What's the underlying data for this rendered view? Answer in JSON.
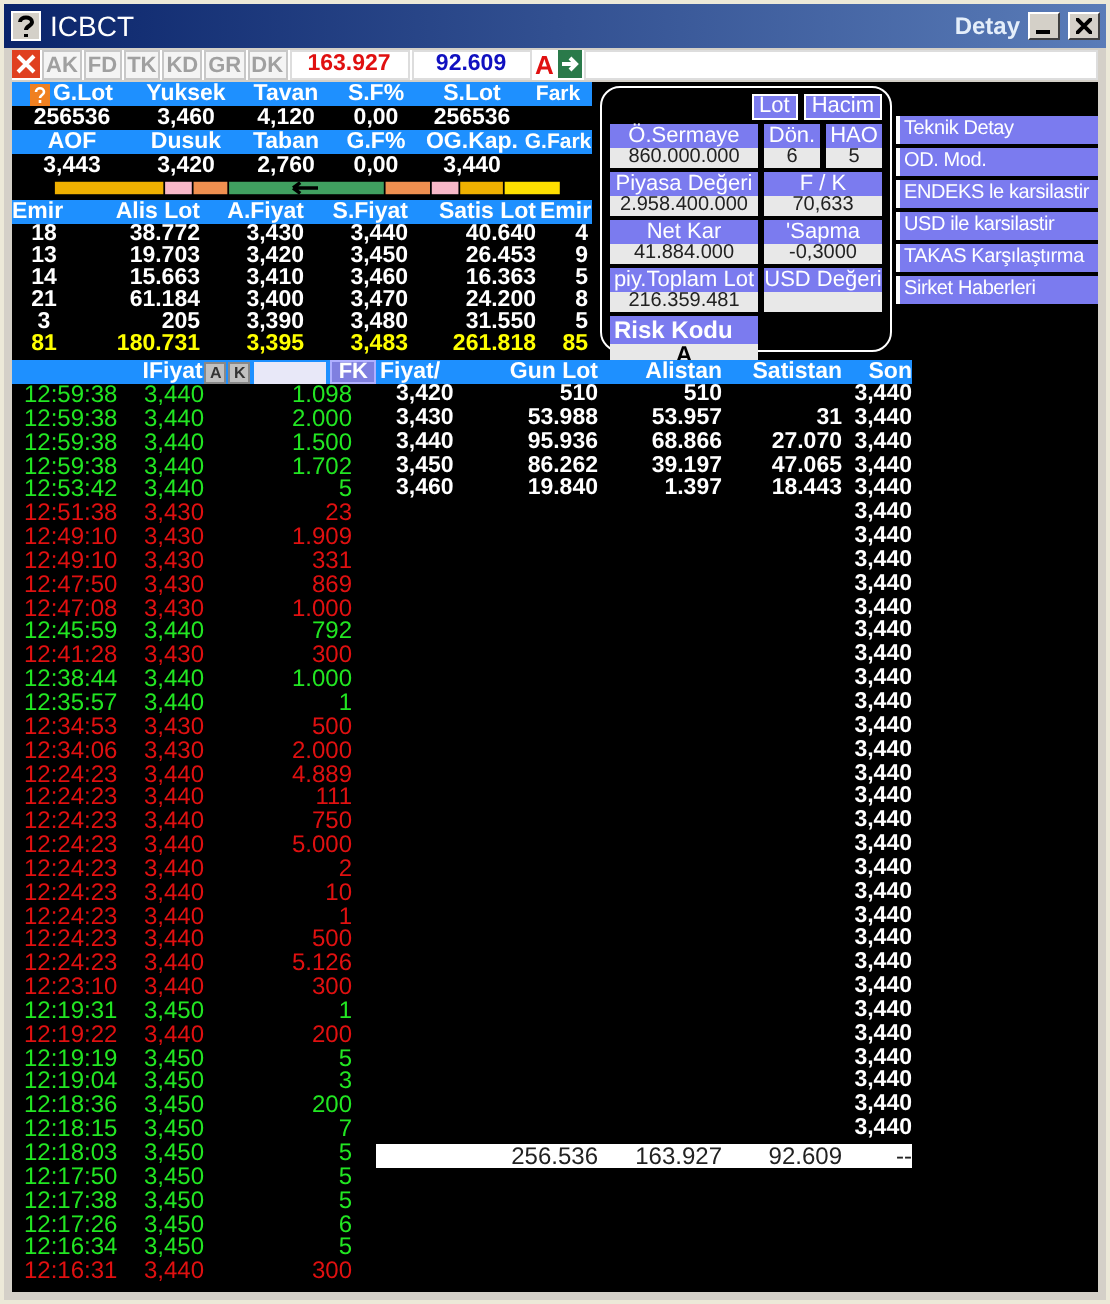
{
  "window": {
    "title": "ICBCT",
    "subtitle": "Detay"
  },
  "toolbar": {
    "tabs": [
      "AK",
      "FD",
      "TK",
      "KD",
      "GR",
      "DK"
    ],
    "field_1": "163.927",
    "field_2": "92.609",
    "mode": "A"
  },
  "stats": [
    [
      {
        "label": "G.Lot",
        "value": "256536"
      },
      {
        "label": "Yuksek",
        "value": "3,460"
      },
      {
        "label": "Tavan",
        "value": "4,120"
      },
      {
        "label": "S.F%",
        "value": "0,00"
      },
      {
        "label": "S.Lot",
        "value": "256536"
      },
      {
        "label": "Fark"
      }
    ],
    [
      {
        "label": "AOF",
        "value": "3,443"
      },
      {
        "label": "Dusuk",
        "value": "3,420"
      },
      {
        "label": "Taban",
        "value": "2,760"
      },
      {
        "label": "G.F%",
        "value": "0,00"
      },
      {
        "label": "OG.Kap.",
        "value": "3,440"
      },
      {
        "label": "G.Fark"
      }
    ]
  ],
  "order_book": {
    "columns": [
      "Emir",
      "Alis Lot",
      "A.Fiyat",
      "S.Fiyat",
      "Satis Lot",
      "Emir"
    ],
    "rows": [
      [
        "18",
        "38.772",
        "3,430",
        "3,440",
        "40.640",
        "4"
      ],
      [
        "13",
        "19.703",
        "3,420",
        "3,450",
        "26.453",
        "9"
      ],
      [
        "14",
        "15.663",
        "3,410",
        "3,460",
        "16.363",
        "5"
      ],
      [
        "21",
        "61.184",
        "3,400",
        "3,470",
        "24.200",
        "8"
      ],
      [
        "3",
        "205",
        "3,390",
        "3,480",
        "31.550",
        "5"
      ]
    ],
    "totals": [
      "81",
      "180.731",
      "3,395",
      "3,483",
      "261.818",
      "85"
    ]
  },
  "detail": {
    "unit_buttons": [
      "Lot",
      "Hacim"
    ],
    "rows": [
      [
        {
          "label": "Ö.Sermaye",
          "value": "860.000.000"
        },
        {
          "label": "Dön.",
          "value": "6"
        },
        {
          "label": "HAO",
          "value": "5"
        }
      ],
      [
        {
          "label": "Piyasa Değeri",
          "value": "2.958.400.000"
        },
        {
          "label": "F / K",
          "value": "70,633"
        }
      ],
      [
        {
          "label": "Net Kar",
          "value": "41.884.000"
        },
        {
          "label": "'Sapma",
          "value": "-0,3000"
        }
      ],
      [
        {
          "label": "piy.Toplam Lot",
          "value": "216.359.481"
        },
        {
          "label": "USD Değeri"
        }
      ]
    ],
    "risk": {
      "label": "Risk Kodu",
      "value": "A"
    }
  },
  "links": [
    "Teknik Detay",
    "OD. Mod.",
    "ENDEKS le karsilastir",
    "USD ile karsilastir",
    "TAKAS Karşılaştırma",
    "Sirket Haberleri"
  ],
  "trades_header": {
    "label": "IFiyat",
    "buttons": [
      "A",
      "K"
    ],
    "filter": "FK"
  },
  "trades": [
    {
      "time": "12:59:38",
      "price": "3,440",
      "lot": "1.098",
      "kind": "buy"
    },
    {
      "time": "12:59:38",
      "price": "3,440",
      "lot": "2.000",
      "kind": "buy"
    },
    {
      "time": "12:59:38",
      "price": "3,440",
      "lot": "1.500",
      "kind": "buy"
    },
    {
      "time": "12:59:38",
      "price": "3,440",
      "lot": "1.702",
      "kind": "buy"
    },
    {
      "time": "12:53:42",
      "price": "3,440",
      "lot": "5",
      "kind": "buy"
    },
    {
      "time": "12:51:38",
      "price": "3,430",
      "lot": "23",
      "kind": "sell"
    },
    {
      "time": "12:49:10",
      "price": "3,430",
      "lot": "1.909",
      "kind": "sell"
    },
    {
      "time": "12:49:10",
      "price": "3,430",
      "lot": "331",
      "kind": "sell"
    },
    {
      "time": "12:47:50",
      "price": "3,430",
      "lot": "869",
      "kind": "sell"
    },
    {
      "time": "12:47:08",
      "price": "3,430",
      "lot": "1.000",
      "kind": "sell"
    },
    {
      "time": "12:45:59",
      "price": "3,440",
      "lot": "792",
      "kind": "buy"
    },
    {
      "time": "12:41:28",
      "price": "3,430",
      "lot": "300",
      "kind": "sell"
    },
    {
      "time": "12:38:44",
      "price": "3,440",
      "lot": "1.000",
      "kind": "buy"
    },
    {
      "time": "12:35:57",
      "price": "3,440",
      "lot": "1",
      "kind": "buy"
    },
    {
      "time": "12:34:53",
      "price": "3,430",
      "lot": "500",
      "kind": "sell"
    },
    {
      "time": "12:34:06",
      "price": "3,430",
      "lot": "2.000",
      "kind": "sell"
    },
    {
      "time": "12:24:23",
      "price": "3,440",
      "lot": "4.889",
      "kind": "sell"
    },
    {
      "time": "12:24:23",
      "price": "3,440",
      "lot": "111",
      "kind": "sell"
    },
    {
      "time": "12:24:23",
      "price": "3,440",
      "lot": "750",
      "kind": "sell"
    },
    {
      "time": "12:24:23",
      "price": "3,440",
      "lot": "5.000",
      "kind": "sell"
    },
    {
      "time": "12:24:23",
      "price": "3,440",
      "lot": "2",
      "kind": "sell"
    },
    {
      "time": "12:24:23",
      "price": "3,440",
      "lot": "10",
      "kind": "sell"
    },
    {
      "time": "12:24:23",
      "price": "3,440",
      "lot": "1",
      "kind": "sell"
    },
    {
      "time": "12:24:23",
      "price": "3,440",
      "lot": "500",
      "kind": "sell"
    },
    {
      "time": "12:24:23",
      "price": "3,440",
      "lot": "5.126",
      "kind": "sell"
    },
    {
      "time": "12:23:10",
      "price": "3,440",
      "lot": "300",
      "kind": "sell"
    },
    {
      "time": "12:19:31",
      "price": "3,450",
      "lot": "1",
      "kind": "buy"
    },
    {
      "time": "12:19:22",
      "price": "3,440",
      "lot": "200",
      "kind": "sell"
    },
    {
      "time": "12:19:19",
      "price": "3,450",
      "lot": "5",
      "kind": "buy"
    },
    {
      "time": "12:19:04",
      "price": "3,450",
      "lot": "3",
      "kind": "buy"
    },
    {
      "time": "12:18:36",
      "price": "3,450",
      "lot": "200",
      "kind": "buy"
    },
    {
      "time": "12:18:15",
      "price": "3,450",
      "lot": "7",
      "kind": "buy"
    },
    {
      "time": "12:18:03",
      "price": "3,450",
      "lot": "5",
      "kind": "buy"
    },
    {
      "time": "12:17:50",
      "price": "3,450",
      "lot": "5",
      "kind": "buy"
    },
    {
      "time": "12:17:38",
      "price": "3,450",
      "lot": "5",
      "kind": "buy"
    },
    {
      "time": "12:17:26",
      "price": "3,450",
      "lot": "6",
      "kind": "buy"
    },
    {
      "time": "12:16:34",
      "price": "3,450",
      "lot": "5",
      "kind": "buy"
    },
    {
      "time": "12:16:31",
      "price": "3,440",
      "lot": "300",
      "kind": "sell"
    }
  ],
  "price_table": {
    "columns": [
      "Fiyat/",
      "Gun Lot",
      "Alistan",
      "Satistan",
      "Son"
    ],
    "rows": [
      {
        "price": "3,420",
        "gun_lot": "510",
        "alistan": "510"
      },
      {
        "price": "3,430",
        "gun_lot": "53.988",
        "alistan": "53.957",
        "satistan": "31"
      },
      {
        "price": "3,440",
        "gun_lot": "95.936",
        "alistan": "68.866",
        "satistan": "27.070"
      },
      {
        "price": "3,450",
        "gun_lot": "86.262",
        "alistan": "39.197",
        "satistan": "47.065"
      },
      {
        "price": "3,460",
        "gun_lot": "19.840",
        "alistan": "1.397",
        "satistan": "18.443"
      }
    ],
    "son": [
      "3,440",
      "3,440",
      "3,440",
      "3,440",
      "3,440",
      "3,440",
      "3,440",
      "3,440",
      "3,440",
      "3,440",
      "3,440",
      "3,440",
      "3,440",
      "3,440",
      "3,440",
      "3,440",
      "3,440",
      "3,440",
      "3,440",
      "3,440",
      "3,440",
      "3,440",
      "3,440",
      "3,440",
      "3,440",
      "3,440",
      "3,440",
      "3,440",
      "3,440",
      "3,440",
      "3,440",
      "3,440"
    ],
    "totals": {
      "gun_lot": "256.536",
      "alistan": "163.927",
      "satistan": "92.609",
      "son": "--"
    }
  }
}
